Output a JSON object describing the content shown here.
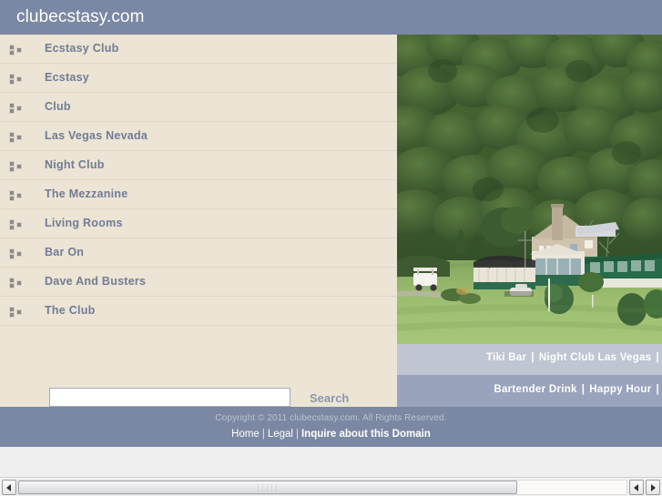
{
  "header": {
    "title": "clubecstasy.com"
  },
  "keywords": {
    "icon": "three-squares-bullet-icon",
    "items": [
      {
        "label": "Ecstasy Club"
      },
      {
        "label": "Ecstasy"
      },
      {
        "label": "Club"
      },
      {
        "label": "Las Vegas Nevada"
      },
      {
        "label": "Night Club"
      },
      {
        "label": "The Mezzanine"
      },
      {
        "label": "Living Rooms"
      },
      {
        "label": "Bar On"
      },
      {
        "label": "Dave And Busters"
      },
      {
        "label": "The Club"
      }
    ]
  },
  "search": {
    "value": "",
    "placeholder": "",
    "button_label": "Search"
  },
  "hero": {
    "alt": "golf course clubhouse with green roof on a manicured fairway, forested hillside behind"
  },
  "related_links": {
    "row1": [
      {
        "label": "Tiki Bar"
      },
      {
        "label": "Night Club Las Vegas"
      }
    ],
    "row1_trailing_separator": "|",
    "row2": [
      {
        "label": "Bartender Drink"
      },
      {
        "label": "Happy Hour"
      }
    ],
    "row2_trailing_separator": "|",
    "separator": "|"
  },
  "footer": {
    "copyright": "Copyright © 2011 clubecstasy.com. All Rights Reserved.",
    "links": [
      {
        "label": "Home",
        "bold": false
      },
      {
        "label": "Legal",
        "bold": false
      },
      {
        "label": "Inquire about this Domain",
        "bold": true
      }
    ],
    "separator": "|"
  },
  "scrollbar": {
    "orientation": "horizontal",
    "left_arrow": "◀",
    "right_arrow": "▶",
    "thumb_position_percent": 0,
    "thumb_width_percent": 82
  },
  "colors": {
    "header_bg": "#7b88a3",
    "panel_bg": "#ece4d4",
    "row_divider": "#e0d8c6",
    "keyword_text": "#717c96",
    "links_row1_bg": "#bfc5d2",
    "links_row2_bg": "#9aa3bc",
    "footer_bg": "#7b88a3",
    "footer_muted_text": "#b9c1d1",
    "page_bg": "#efefef"
  }
}
